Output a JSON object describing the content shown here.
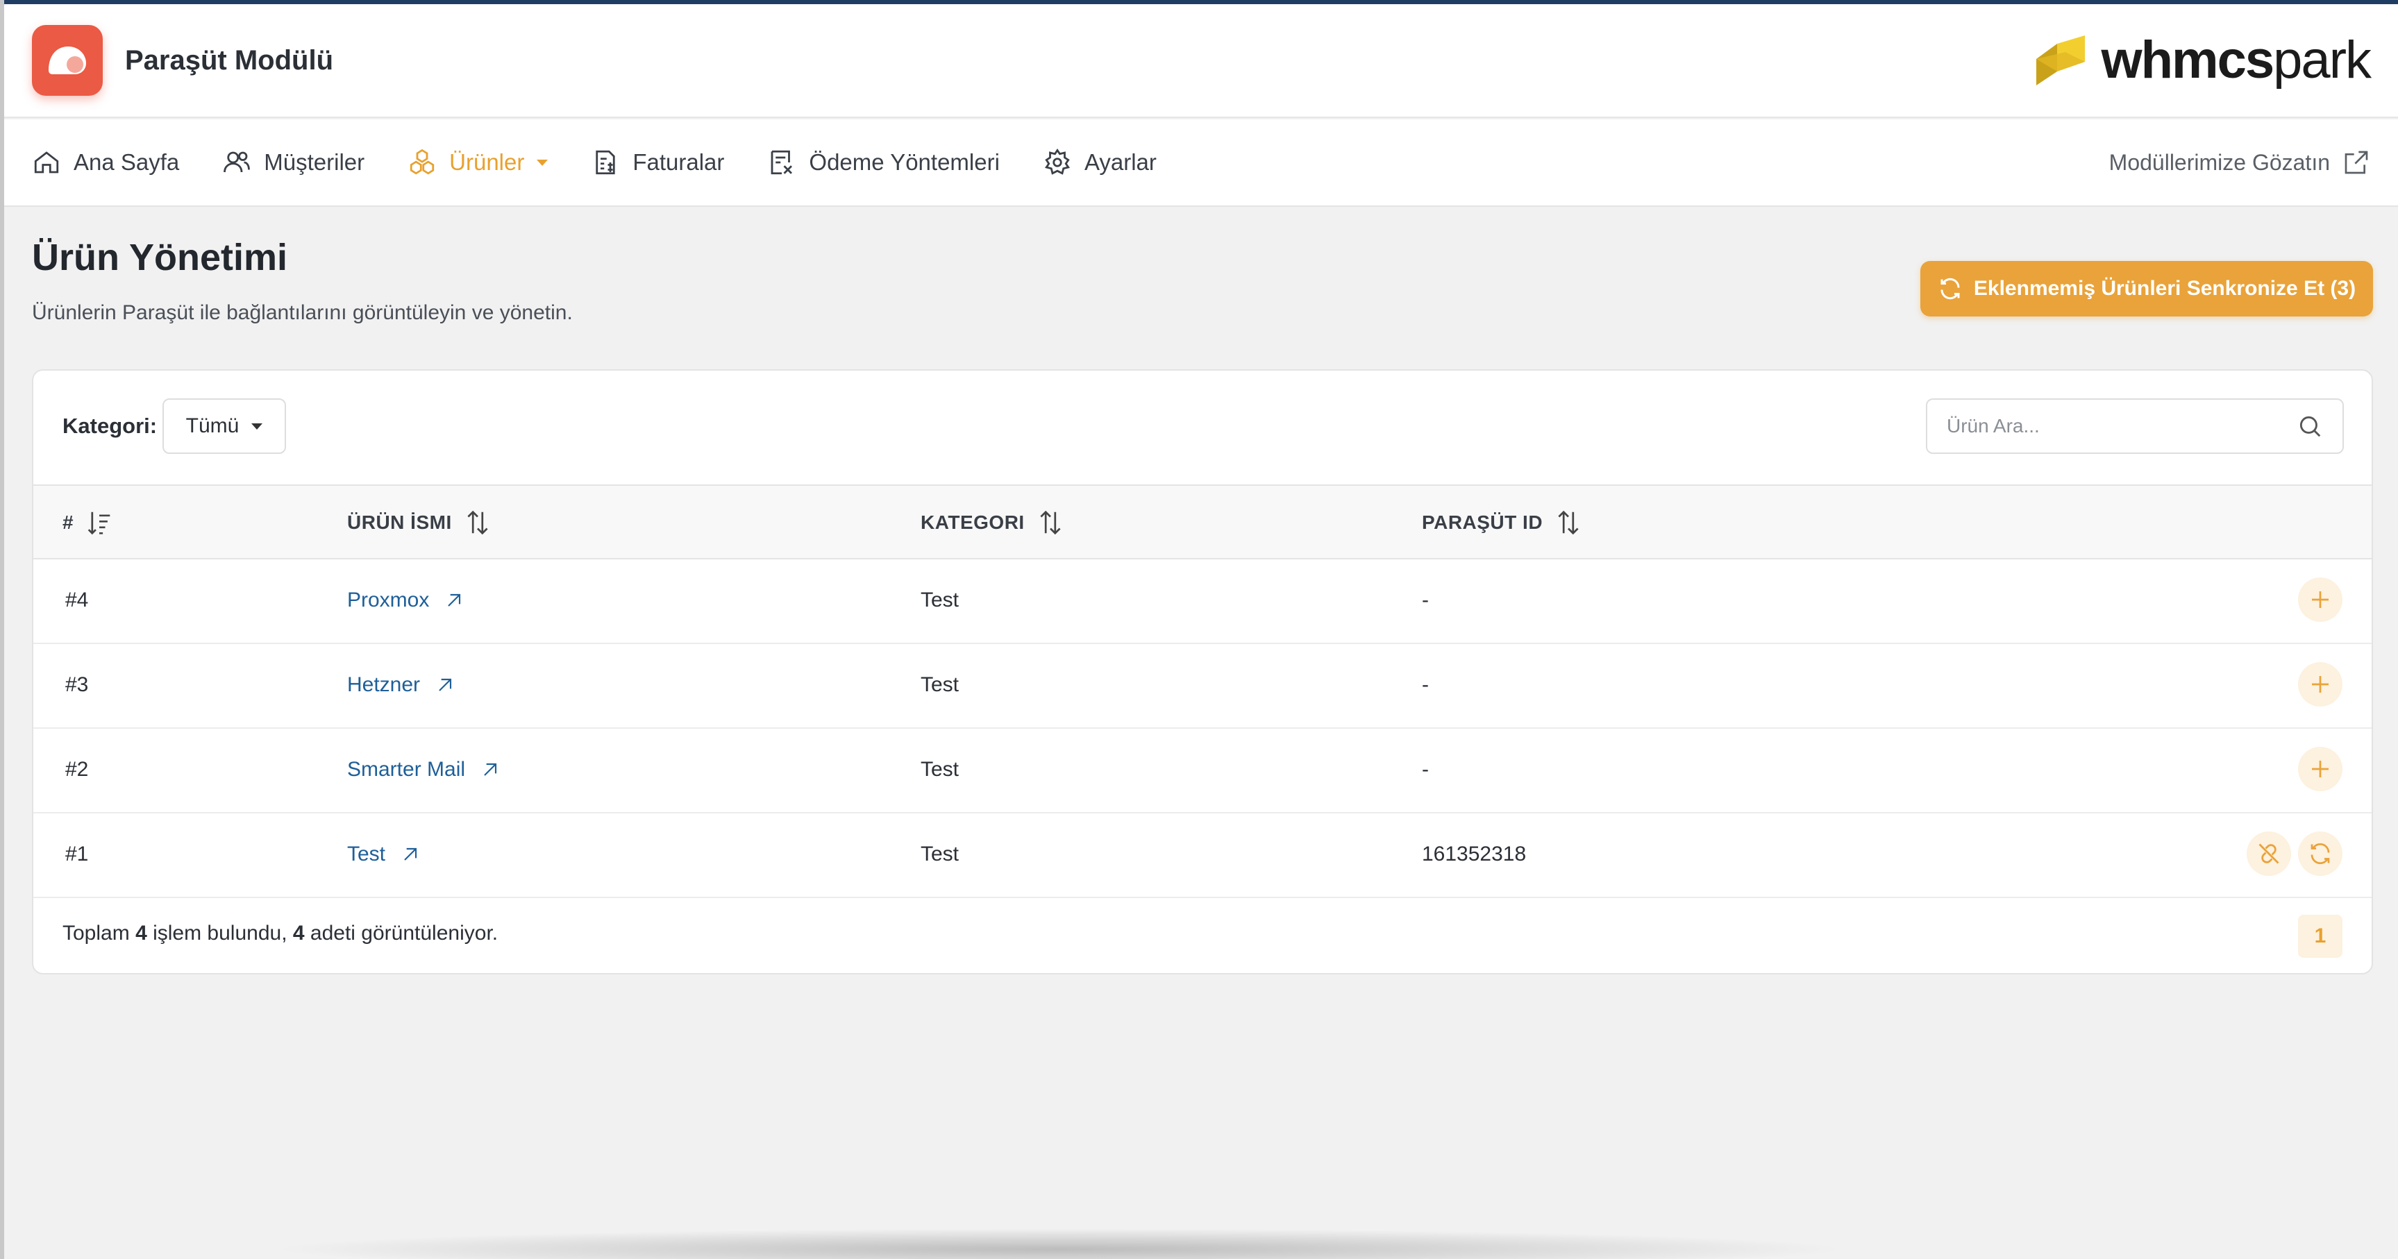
{
  "header": {
    "app_title": "Paraşüt Modülü",
    "brand_bold": "whmcs",
    "brand_light": "park"
  },
  "nav": {
    "items": [
      {
        "label": "Ana Sayfa",
        "icon": "home-icon"
      },
      {
        "label": "Müşteriler",
        "icon": "users-icon"
      },
      {
        "label": "Ürünler",
        "icon": "products-icon",
        "active": true
      },
      {
        "label": "Faturalar",
        "icon": "invoice-icon"
      },
      {
        "label": "Ödeme Yöntemleri",
        "icon": "payment-methods-icon"
      },
      {
        "label": "Ayarlar",
        "icon": "gear-icon"
      }
    ],
    "external_link": "Modüllerimize Gözatın"
  },
  "page": {
    "title": "Ürün Yönetimi",
    "subtitle": "Ürünlerin Paraşüt ile bağlantılarını görüntüleyin ve yönetin.",
    "sync_button": "Eklenmemiş Ürünleri Senkronize Et (3)"
  },
  "filters": {
    "category_label": "Kategori:",
    "category_value": "Tümü",
    "search_placeholder": "Ürün Ara..."
  },
  "table": {
    "columns": [
      "#",
      "ÜRÜN İSMI",
      "KATEGORI",
      "PARAŞÜT ID"
    ],
    "rows": [
      {
        "id": "#4",
        "name": "Proxmox",
        "category": "Test",
        "parasut_id": "-"
      },
      {
        "id": "#3",
        "name": "Hetzner",
        "category": "Test",
        "parasut_id": "-"
      },
      {
        "id": "#2",
        "name": "Smarter Mail",
        "category": "Test",
        "parasut_id": "-"
      },
      {
        "id": "#1",
        "name": "Test",
        "category": "Test",
        "parasut_id": "161352318"
      }
    ]
  },
  "footer": {
    "prefix": "Toplam",
    "total": "4",
    "middle": "işlem bulundu,",
    "shown": "4",
    "suffix": "adeti görüntüleniyor.",
    "current_page": "1"
  },
  "colors": {
    "accent": "#e9a33a",
    "link": "#1e5f99",
    "logo": "#ea5a44"
  }
}
